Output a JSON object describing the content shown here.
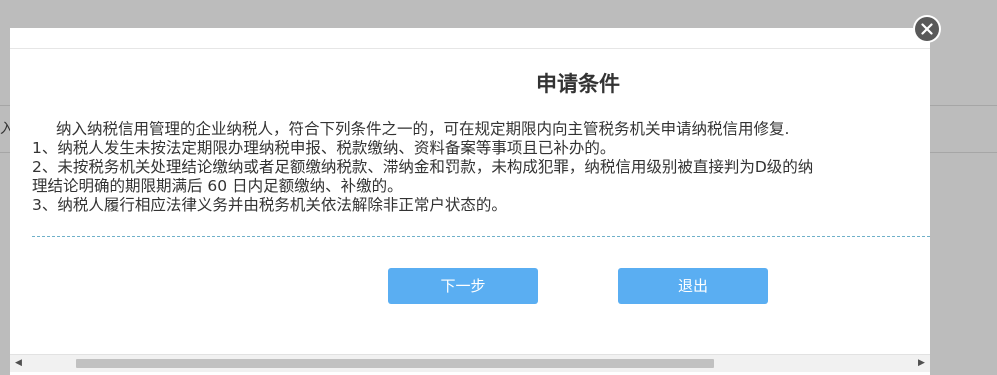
{
  "background": {
    "fragment_text": "入"
  },
  "modal": {
    "title": "申请条件",
    "intro": "纳入纳税信用管理的企业纳税人，符合下列条件之一的，可在规定期限内向主管税务机关申请纳税信用修复.",
    "conditions": [
      "1、纳税人发生未按法定期限办理纳税申报、税款缴纳、资料备案等事项且已补办的。",
      "2、未按税务机关处理结论缴纳或者足额缴纳税款、滞纳金和罚款，未构成犯罪，纳税信用级别被直接判为D级的纳",
      "理结论明确的期限期满后 60 日内足额缴纳、补缴的。",
      "3、纳税人履行相应法律义务并由税务机关依法解除非正常户状态的。"
    ],
    "buttons": {
      "next_label": "下一步",
      "exit_label": "退出"
    },
    "scrollbar": {
      "left_arrow": "◀",
      "right_arrow": "▶"
    },
    "close_icon": "close-icon"
  },
  "colors": {
    "button": "#5aaef2",
    "divider": "#6fb0c9",
    "close": "#595959"
  }
}
